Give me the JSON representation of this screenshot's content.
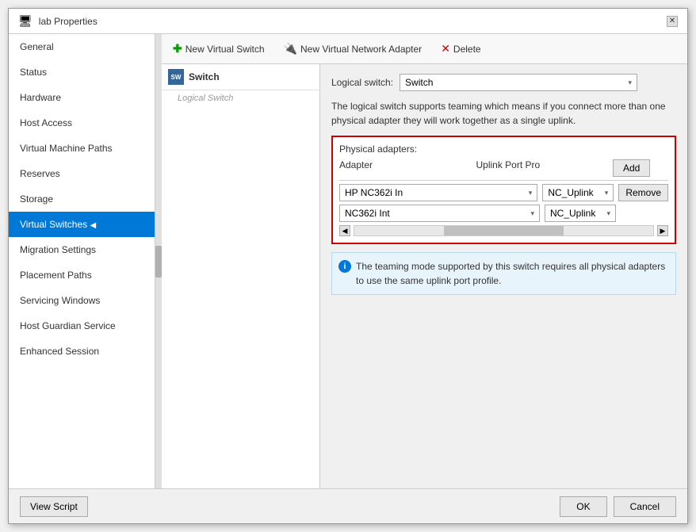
{
  "dialog": {
    "title": "lab Properties",
    "close_label": "✕"
  },
  "sidebar": {
    "items": [
      {
        "id": "general",
        "label": "General",
        "active": false
      },
      {
        "id": "status",
        "label": "Status",
        "active": false
      },
      {
        "id": "hardware",
        "label": "Hardware",
        "active": false
      },
      {
        "id": "host-access",
        "label": "Host Access",
        "active": false
      },
      {
        "id": "vm-paths",
        "label": "Virtual Machine Paths",
        "active": false
      },
      {
        "id": "reserves",
        "label": "Reserves",
        "active": false
      },
      {
        "id": "storage",
        "label": "Storage",
        "active": false
      },
      {
        "id": "virtual-switches",
        "label": "Virtual Switches",
        "active": true
      },
      {
        "id": "migration-settings",
        "label": "Migration Settings",
        "active": false
      },
      {
        "id": "placement-paths",
        "label": "Placement Paths",
        "active": false
      },
      {
        "id": "servicing-windows",
        "label": "Servicing Windows",
        "active": false
      },
      {
        "id": "host-guardian",
        "label": "Host Guardian Service",
        "active": false
      },
      {
        "id": "enhanced-session",
        "label": "Enhanced Session",
        "active": false
      }
    ]
  },
  "toolbar": {
    "new_virtual_switch_label": "New Virtual Switch",
    "new_virtual_network_adapter_label": "New Virtual Network Adapter",
    "delete_label": "Delete"
  },
  "tree": {
    "switch_label": "Switch",
    "logical_switch_sub": "Logical Switch"
  },
  "right_panel": {
    "logical_switch_label": "Logical switch:",
    "logical_switch_value": "Switch",
    "description": "The logical switch supports teaming which means if you connect more than one physical adapter they will work together as a single uplink.",
    "physical_adapters_label": "Physical adapters:",
    "col_adapter": "Adapter",
    "col_uplink": "Uplink Port Pro",
    "add_btn": "Add",
    "remove_btn": "Remove",
    "adapters": [
      {
        "adapter": "HP NC362i In",
        "uplink": "NC_Uplink"
      },
      {
        "adapter": "NC362i Int",
        "uplink": "NC_Uplink"
      }
    ],
    "info_text": "The teaming mode supported by this switch requires all physical adapters to use the same uplink port profile."
  },
  "footer": {
    "view_script": "View Script",
    "ok": "OK",
    "cancel": "Cancel"
  }
}
